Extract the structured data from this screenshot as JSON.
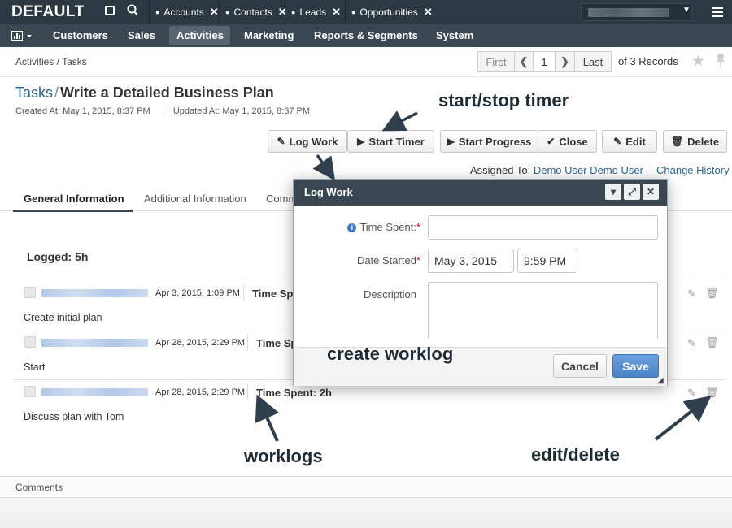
{
  "topbar": {
    "logo": "DEFAULT",
    "tabs": [
      "Accounts",
      "Contacts",
      "Leads",
      "Opportunities"
    ]
  },
  "nav": {
    "items": [
      "Customers",
      "Sales",
      "Activities",
      "Marketing",
      "Reports & Segments",
      "System"
    ],
    "active": "Activities"
  },
  "breadcrumb": "Activities / Tasks",
  "pager": {
    "first": "First",
    "page": "1",
    "last": "Last",
    "records": "of 3 Records"
  },
  "header": {
    "link": "Tasks",
    "separator": "/",
    "title": "Write a Detailed Business Plan",
    "created": "Created At: May 1, 2015, 8:37 PM",
    "updated": "Updated At: May 1, 2015, 8:37 PM"
  },
  "buttons": {
    "log_work": "Log Work",
    "start_timer": "Start Timer",
    "start_progress": "Start Progress",
    "close": "Close",
    "edit": "Edit",
    "delete": "Delete"
  },
  "assigned": {
    "label": "Assigned To:",
    "user": "Demo User Demo User",
    "change_history": "Change History"
  },
  "tabs": [
    "General Information",
    "Additional Information",
    "Comm"
  ],
  "worklog": {
    "logged": "Logged: 5h",
    "entries": [
      {
        "date": "Apr 3, 2015, 1:09 PM",
        "spent": "Time Spe",
        "description": "Create initial plan"
      },
      {
        "date": "Apr 28, 2015, 2:29 PM",
        "spent": "Time Sp",
        "description": "Start"
      },
      {
        "date": "Apr 28, 2015, 2:29 PM",
        "spent": "Time Spent: 2h",
        "description": "Discuss plan with Tom"
      }
    ]
  },
  "comments": "Comments",
  "modal": {
    "title": "Log Work",
    "time_spent_label": "Time Spent:",
    "date_started_label": "Date Started",
    "date": "May 3, 2015",
    "time": "9:59 PM",
    "description_label": "Description",
    "cancel": "Cancel",
    "save": "Save"
  },
  "annotations": {
    "timer": "start/stop timer",
    "create": "create worklog",
    "worklogs": "worklogs",
    "editdelete": "edit/delete"
  }
}
